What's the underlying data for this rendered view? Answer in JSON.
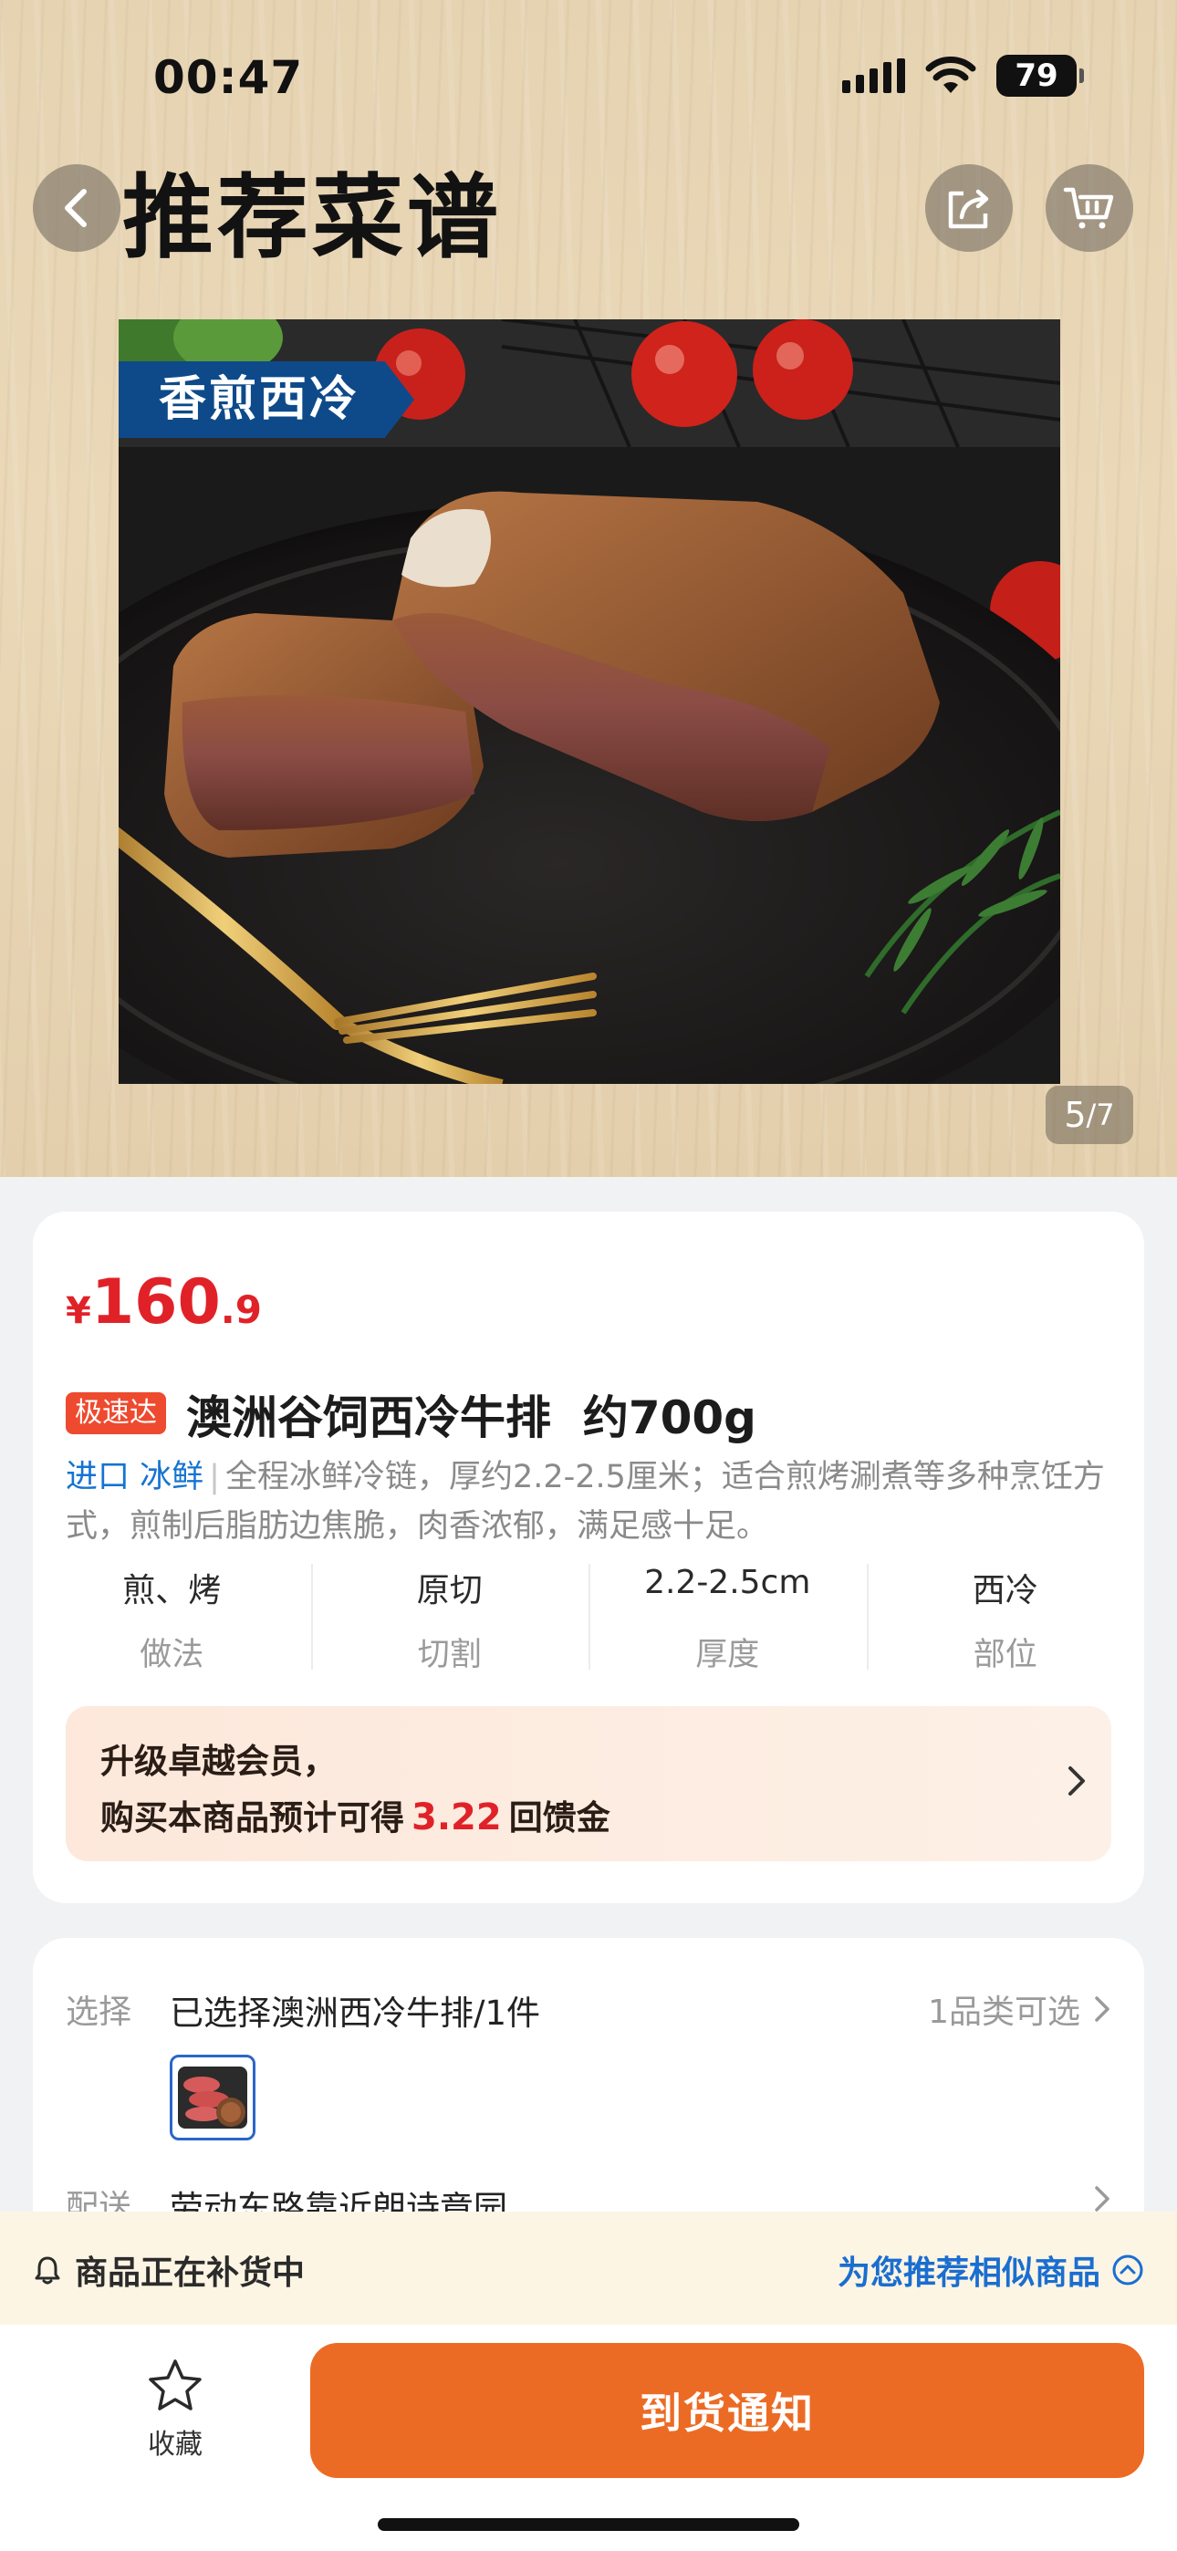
{
  "status": {
    "time": "00:47",
    "battery": "79"
  },
  "header": {
    "title": "推荐菜谱"
  },
  "gallery": {
    "tag": "香煎西冷",
    "pager_current": "5",
    "pager_total": "/7"
  },
  "product": {
    "price_currency": "¥",
    "price_integer": "160",
    "price_decimal": ".9",
    "badge": "极速达",
    "title": "澳洲谷饲西冷牛排  约700g",
    "tag_import": "进口",
    "tag_fresh": "冰鲜",
    "separator": "|",
    "description": "全程冰鲜冷链，厚约2.2-2.5厘米；适合煎烤涮煮等多种烹饪方式，煎制后脂肪边焦脆，肉香浓郁，满足感十足。",
    "specs": [
      {
        "value": "煎、烤",
        "label": "做法"
      },
      {
        "value": "原切",
        "label": "切割"
      },
      {
        "value": "2.2-2.5cm",
        "label": "厚度"
      },
      {
        "value": "西冷",
        "label": "部位"
      }
    ]
  },
  "membership": {
    "line1": "升级卓越会员，",
    "line2_prefix": "购买本商品预计可得",
    "amount": "3.22",
    "line2_suffix": "回馈金"
  },
  "selection": {
    "label": "选择",
    "value": "已选择澳洲西冷牛排/1件",
    "right": "1品类可选"
  },
  "delivery": {
    "label": "配送",
    "value": "劳动东路靠近朗诗竟园"
  },
  "restock": {
    "message": "商品正在补货中",
    "link": "为您推荐相似商品"
  },
  "bottom_bar": {
    "favorite_label": "收藏",
    "notify_label": "到货通知"
  },
  "colors": {
    "price": "#e02228",
    "accent_orange": "#ec6b24",
    "link_blue": "#1a6ed0",
    "badge_bg": "#ee4a2f"
  },
  "icons": [
    "back-icon",
    "share-icon",
    "cart-icon",
    "chevron-right-icon",
    "bell-icon",
    "chevron-up-circle-icon",
    "star-icon"
  ]
}
